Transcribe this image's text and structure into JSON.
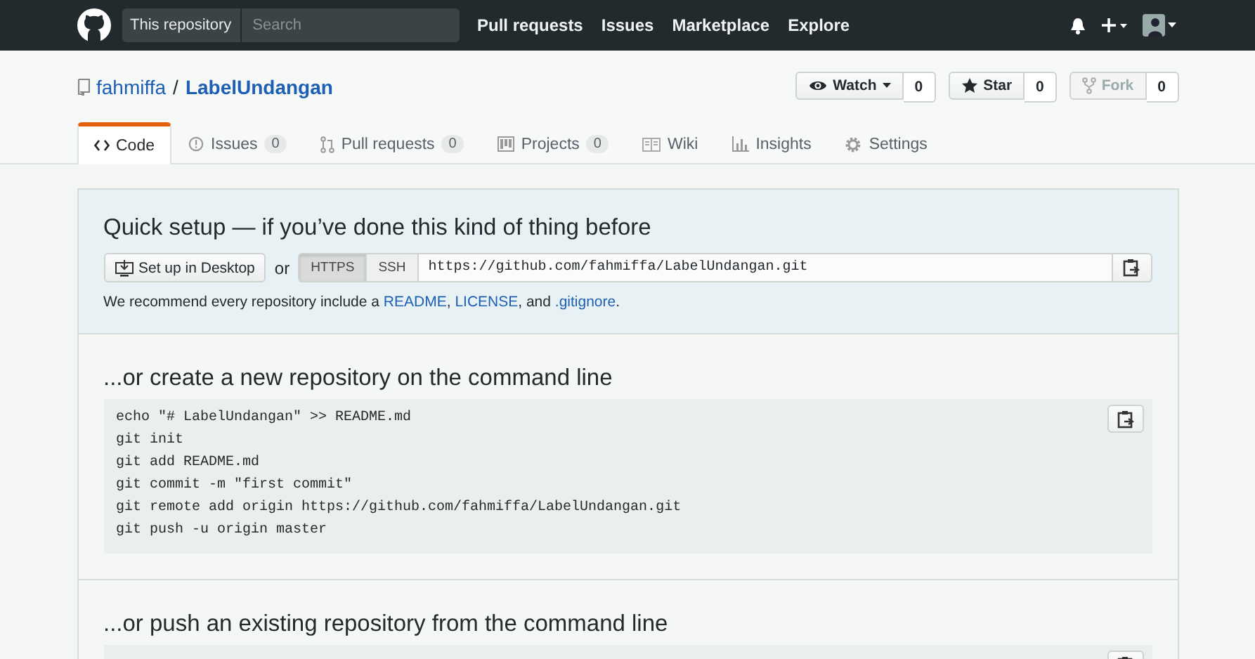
{
  "header": {
    "scope": "This repository",
    "search_placeholder": "Search",
    "nav": [
      "Pull requests",
      "Issues",
      "Marketplace",
      "Explore"
    ]
  },
  "repo": {
    "owner": "fahmiffa",
    "separator": "/",
    "name": "LabelUndangan",
    "actions": [
      {
        "kind": "watch",
        "label": "Watch",
        "count": "0",
        "disabled": false
      },
      {
        "kind": "star",
        "label": "Star",
        "count": "0",
        "disabled": false
      },
      {
        "kind": "fork",
        "label": "Fork",
        "count": "0",
        "disabled": true
      }
    ]
  },
  "tabs": [
    {
      "kind": "code",
      "label": "Code",
      "selected": true
    },
    {
      "kind": "issues",
      "label": "Issues",
      "count": "0",
      "selected": false
    },
    {
      "kind": "pulls",
      "label": "Pull requests",
      "count": "0",
      "selected": false
    },
    {
      "kind": "projects",
      "label": "Projects",
      "count": "0",
      "selected": false
    },
    {
      "kind": "wiki",
      "label": "Wiki",
      "selected": false
    },
    {
      "kind": "insights",
      "label": "Insights",
      "selected": false
    },
    {
      "kind": "settings",
      "label": "Settings",
      "selected": false
    }
  ],
  "quick_setup": {
    "title": "Quick setup — if you’ve done this kind of thing before",
    "desktop_button": "Set up in Desktop",
    "or": "or",
    "protocols": [
      {
        "label": "HTTPS",
        "selected": true
      },
      {
        "label": "SSH",
        "selected": false
      }
    ],
    "url": "https://github.com/fahmiffa/LabelUndangan.git",
    "recommend": [
      {
        "text": "We recommend every repository include a "
      },
      {
        "text": "README",
        "link": true
      },
      {
        "text": ", "
      },
      {
        "text": "LICENSE",
        "link": true
      },
      {
        "text": ", and "
      },
      {
        "text": ".gitignore",
        "link": true
      },
      {
        "text": "."
      }
    ]
  },
  "sections": [
    {
      "title": "...or create a new repository on the command line",
      "lines": [
        "echo \"# LabelUndangan\" >> README.md",
        "git init",
        "git add README.md",
        "git commit -m \"first commit\"",
        "git remote add origin https://github.com/fahmiffa/LabelUndangan.git",
        "git push -u origin master"
      ]
    },
    {
      "title": "...or push an existing repository from the command line"
    }
  ]
}
